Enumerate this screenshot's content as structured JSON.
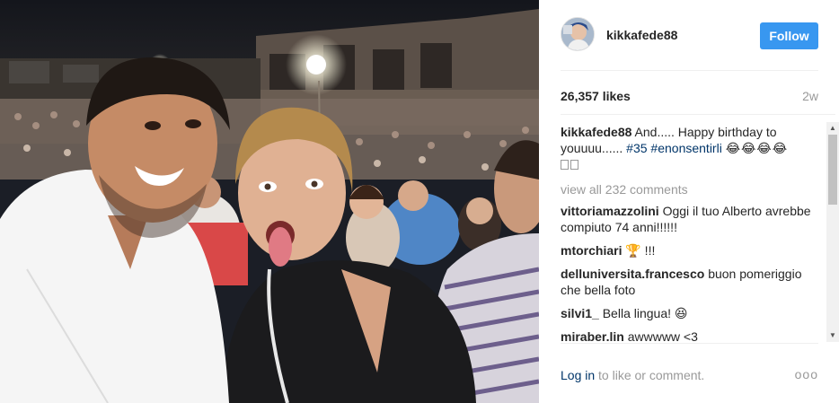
{
  "post": {
    "username": "kikkafede88",
    "follow_label": "Follow",
    "likes_text": "26,357 likes",
    "time_ago": "2w"
  },
  "caption": {
    "user": "kikkafede88",
    "text": "And..... Happy birthday to youuuu...... ",
    "hashtag_1": "#35",
    "hashtag_2": "#enonsentirli",
    "emoji": "😂😂😂😂"
  },
  "view_all_comments": "view all 232 comments",
  "comments": [
    {
      "user": "vittoriamazzolini",
      "text": "Oggi il tuo Alberto avrebbe compiuto 74 anni!!!!!!"
    },
    {
      "user": "mtorchiari",
      "text": "🏆 !!!"
    },
    {
      "user": "delluniversita.francesco",
      "text": "buon pomeriggio che bella foto"
    },
    {
      "user": "silvi1_",
      "text": "Bella lingua! 😆"
    },
    {
      "user": "miraber.lin",
      "text": "awwwww <3"
    }
  ],
  "footer": {
    "login_label": "Log in",
    "login_suffix": " to like or comment.",
    "more_label": "ooo"
  },
  "colors": {
    "follow_button": "#3897f0",
    "link": "#003569",
    "muted": "#999999"
  },
  "icons": {
    "scroll_up": "up-arrow-icon",
    "scroll_down": "down-arrow-icon"
  }
}
